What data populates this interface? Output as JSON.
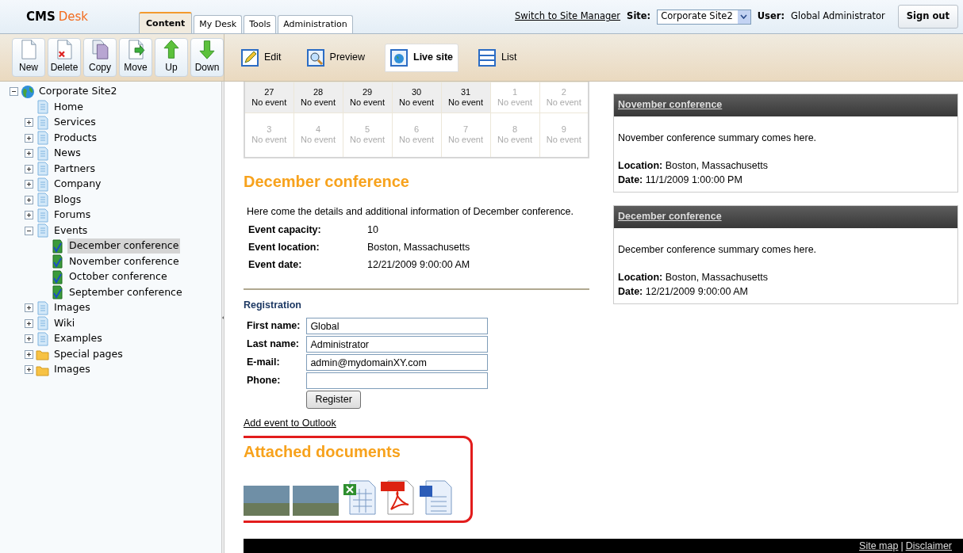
{
  "header": {
    "logo": [
      "CMS",
      "Desk"
    ],
    "tabs": [
      {
        "label": "Content",
        "selected": true
      },
      {
        "label": "My Desk",
        "selected": false
      },
      {
        "label": "Tools",
        "selected": false
      },
      {
        "label": "Administration",
        "selected": false
      }
    ],
    "switch_link": "Switch to Site Manager",
    "site_label": "Site:",
    "site_value": "Corporate Site2",
    "user_label": "User:",
    "user_name": "Global Administrator",
    "sign_out": "Sign out"
  },
  "toolbar": {
    "actions": [
      "New",
      "Delete",
      "Copy",
      "Move",
      "Up",
      "Down"
    ],
    "views": [
      {
        "label": "Edit",
        "selected": false
      },
      {
        "label": "Preview",
        "selected": false
      },
      {
        "label": "Live site",
        "selected": true
      },
      {
        "label": "List",
        "selected": false
      }
    ]
  },
  "tree": [
    {
      "label": "Corporate Site2",
      "kind": "site",
      "expanded": true,
      "selected": false,
      "children": [
        {
          "label": "Home",
          "kind": "page",
          "selected": false
        },
        {
          "label": "Services",
          "kind": "page",
          "expanded": false,
          "selected": false
        },
        {
          "label": "Products",
          "kind": "page",
          "expanded": false,
          "selected": false
        },
        {
          "label": "News",
          "kind": "page",
          "expanded": false,
          "selected": false
        },
        {
          "label": "Partners",
          "kind": "page",
          "expanded": false,
          "selected": false
        },
        {
          "label": "Company",
          "kind": "page",
          "expanded": false,
          "selected": false
        },
        {
          "label": "Blogs",
          "kind": "page",
          "expanded": false,
          "selected": false
        },
        {
          "label": "Forums",
          "kind": "page",
          "expanded": false,
          "selected": false
        },
        {
          "label": "Events",
          "kind": "page",
          "expanded": true,
          "selected": false,
          "children": [
            {
              "label": "December conference",
              "kind": "event",
              "selected": true
            },
            {
              "label": "November conference",
              "kind": "event",
              "selected": false
            },
            {
              "label": "October conference",
              "kind": "event",
              "selected": false
            },
            {
              "label": "September conference",
              "kind": "event",
              "selected": false
            }
          ]
        },
        {
          "label": "Images",
          "kind": "page",
          "expanded": false,
          "selected": false
        },
        {
          "label": "Wiki",
          "kind": "page",
          "expanded": false,
          "selected": false
        },
        {
          "label": "Examples",
          "kind": "page",
          "expanded": false,
          "selected": false
        },
        {
          "label": "Special pages",
          "kind": "folder",
          "expanded": false,
          "selected": false
        },
        {
          "label": "Images",
          "kind": "folder",
          "expanded": false,
          "selected": false
        }
      ]
    }
  ],
  "calendar": {
    "rows": [
      [
        {
          "day": "27",
          "text": "No event",
          "current_month": true
        },
        {
          "day": "28",
          "text": "No event",
          "current_month": true
        },
        {
          "day": "29",
          "text": "No event",
          "current_month": true
        },
        {
          "day": "30",
          "text": "No event",
          "current_month": true
        },
        {
          "day": "31",
          "text": "No event",
          "current_month": true
        },
        {
          "day": "1",
          "text": "No event",
          "current_month": false
        },
        {
          "day": "2",
          "text": "No event",
          "current_month": false
        }
      ],
      [
        {
          "day": "3",
          "text": "No event",
          "current_month": false
        },
        {
          "day": "4",
          "text": "No event",
          "current_month": false
        },
        {
          "day": "5",
          "text": "No event",
          "current_month": false
        },
        {
          "day": "6",
          "text": "No event",
          "current_month": false
        },
        {
          "day": "7",
          "text": "No event",
          "current_month": false
        },
        {
          "day": "8",
          "text": "No event",
          "current_month": false
        },
        {
          "day": "9",
          "text": "No event",
          "current_month": false
        }
      ]
    ]
  },
  "event": {
    "title": "December conference",
    "description": "Here come the details and additional information of December conference.",
    "details": [
      {
        "label": "Event capacity:",
        "value": "10"
      },
      {
        "label": "Event location:",
        "value": "Boston, Massachusetts"
      },
      {
        "label": "Event date:",
        "value": "12/21/2009 9:00:00 AM"
      }
    ]
  },
  "registration": {
    "title": "Registration",
    "fields": [
      {
        "label": "First name:",
        "value": "Global"
      },
      {
        "label": "Last name:",
        "value": "Administrator"
      },
      {
        "label": "E-mail:",
        "value": "admin@mydomainXY.com"
      },
      {
        "label": "Phone:"
      }
    ],
    "button": "Register"
  },
  "outlook_link": "Add event to Outlook",
  "attachments": {
    "title": "Attached documents",
    "files": [
      {
        "kind": "photo"
      },
      {
        "kind": "photo"
      },
      {
        "kind": "spreadsheet"
      },
      {
        "kind": "pdf"
      },
      {
        "kind": "document"
      }
    ]
  },
  "event_cards": [
    {
      "title": "November conference",
      "summary": "November conference summary comes here.",
      "location": "**Location:** Boston, Massachusetts",
      "date": "**Date:** 11/1/2009 1:00:00 PM"
    },
    {
      "title": "December conference",
      "summary": "December conference summary comes here.",
      "location": "**Location:** Boston, Massachusetts",
      "date": "**Date:** 12/21/2009 9:00:00 AM"
    }
  ],
  "footer": {
    "links": [
      "Site map",
      "Disclaimer"
    ],
    "separator": "|"
  }
}
